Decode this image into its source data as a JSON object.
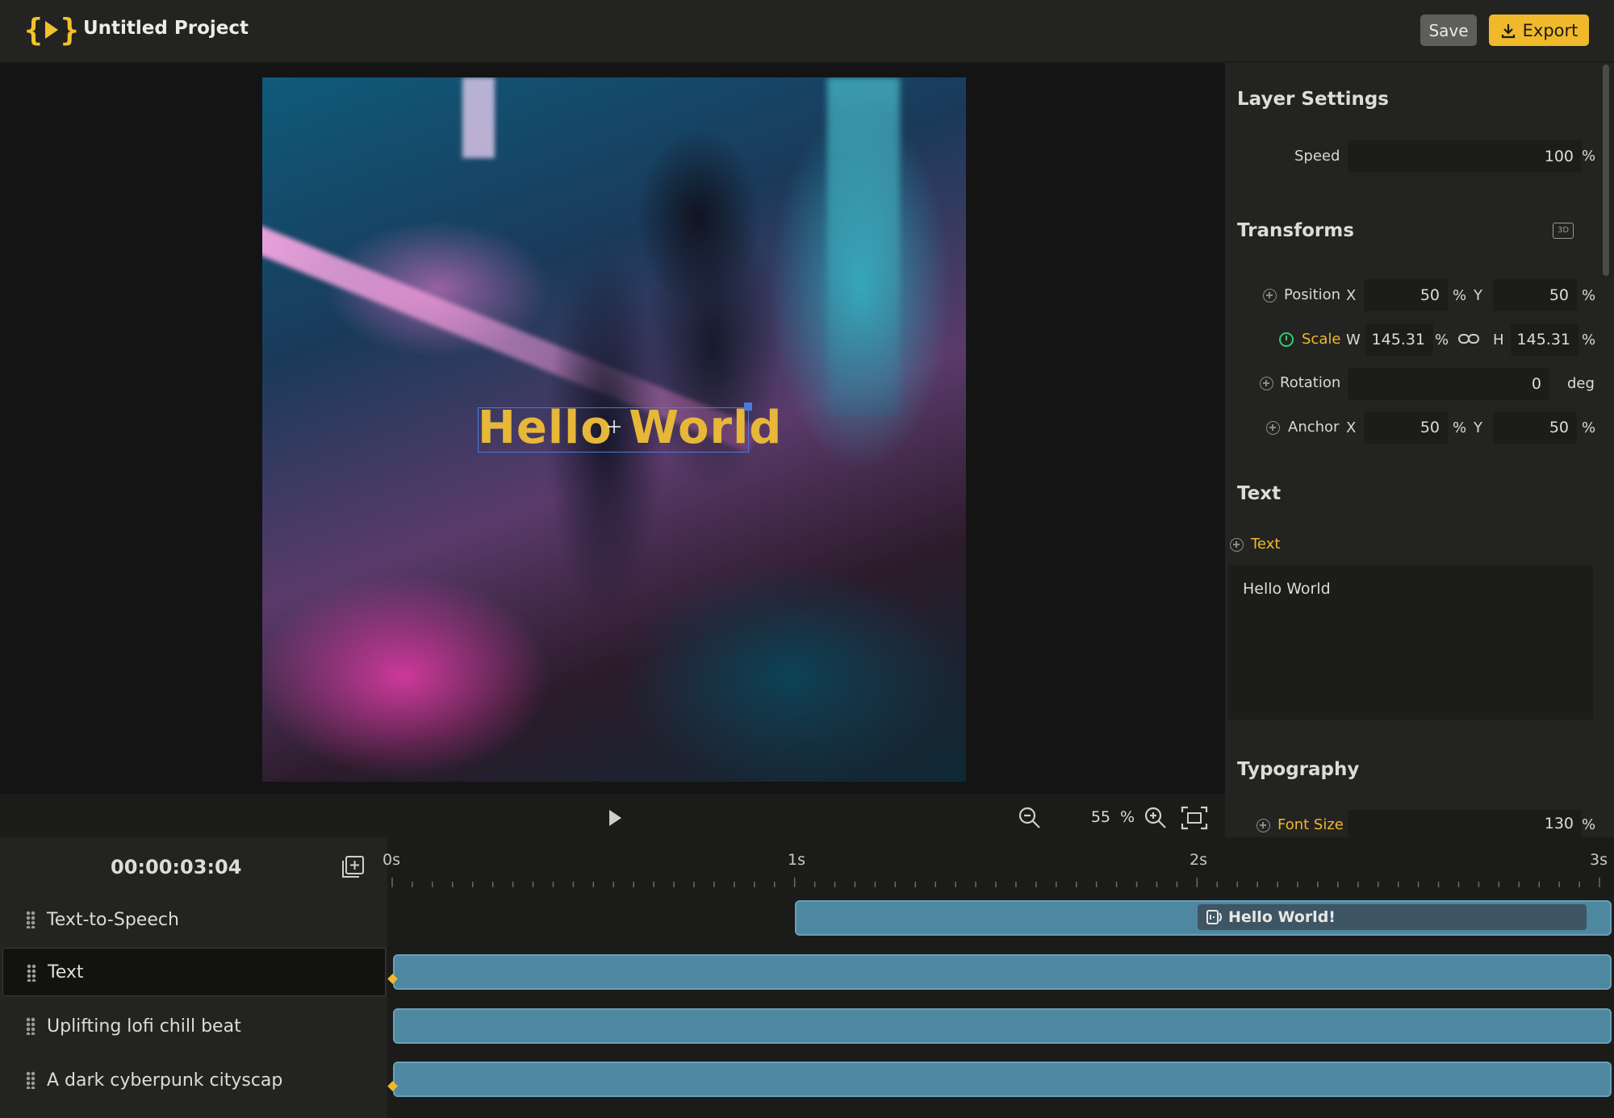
{
  "app": {
    "title": "Untitled Project",
    "save_label": "Save",
    "export_label": "Export"
  },
  "preview": {
    "overlay_text": "Hello World",
    "zoom_value": "55",
    "zoom_unit": "%"
  },
  "panel": {
    "layer_settings": {
      "title": "Layer Settings",
      "speed_label": "Speed",
      "speed_value": "100",
      "speed_unit": "%"
    },
    "transforms": {
      "title": "Transforms",
      "badge": "3D",
      "position": {
        "label": "Position",
        "x_label": "X",
        "x": "50",
        "x_unit": "%",
        "y_label": "Y",
        "y": "50",
        "y_unit": "%"
      },
      "scale": {
        "label": "Scale",
        "w_label": "W",
        "w": "145.31",
        "w_unit": "%",
        "h_label": "H",
        "h": "145.31",
        "h_unit": "%"
      },
      "rotation": {
        "label": "Rotation",
        "value": "0",
        "unit": "deg"
      },
      "anchor": {
        "label": "Anchor",
        "x_label": "X",
        "x": "50",
        "x_unit": "%",
        "y_label": "Y",
        "y": "50",
        "y_unit": "%"
      }
    },
    "text": {
      "title": "Text",
      "field_label": "Text",
      "value": "Hello World"
    },
    "typography": {
      "title": "Typography",
      "font_size_label": "Font Size",
      "font_size_value": "130",
      "font_size_unit": "%"
    }
  },
  "timeline": {
    "timecode": "00:00:03:04",
    "ruler": [
      "0s",
      "1s",
      "2s",
      "3s"
    ],
    "tracks": [
      {
        "name": "Text-to-Speech",
        "clip_label": "Hello World!"
      },
      {
        "name": "Text"
      },
      {
        "name": "Uplifting lofi chill beat"
      },
      {
        "name": "A dark cyberpunk cityscap"
      }
    ]
  },
  "colors": {
    "accent": "#f0b92b",
    "clip": "#4e87a0",
    "keyframe_active": "#2ecc71",
    "selection": "#4a7bd8"
  }
}
